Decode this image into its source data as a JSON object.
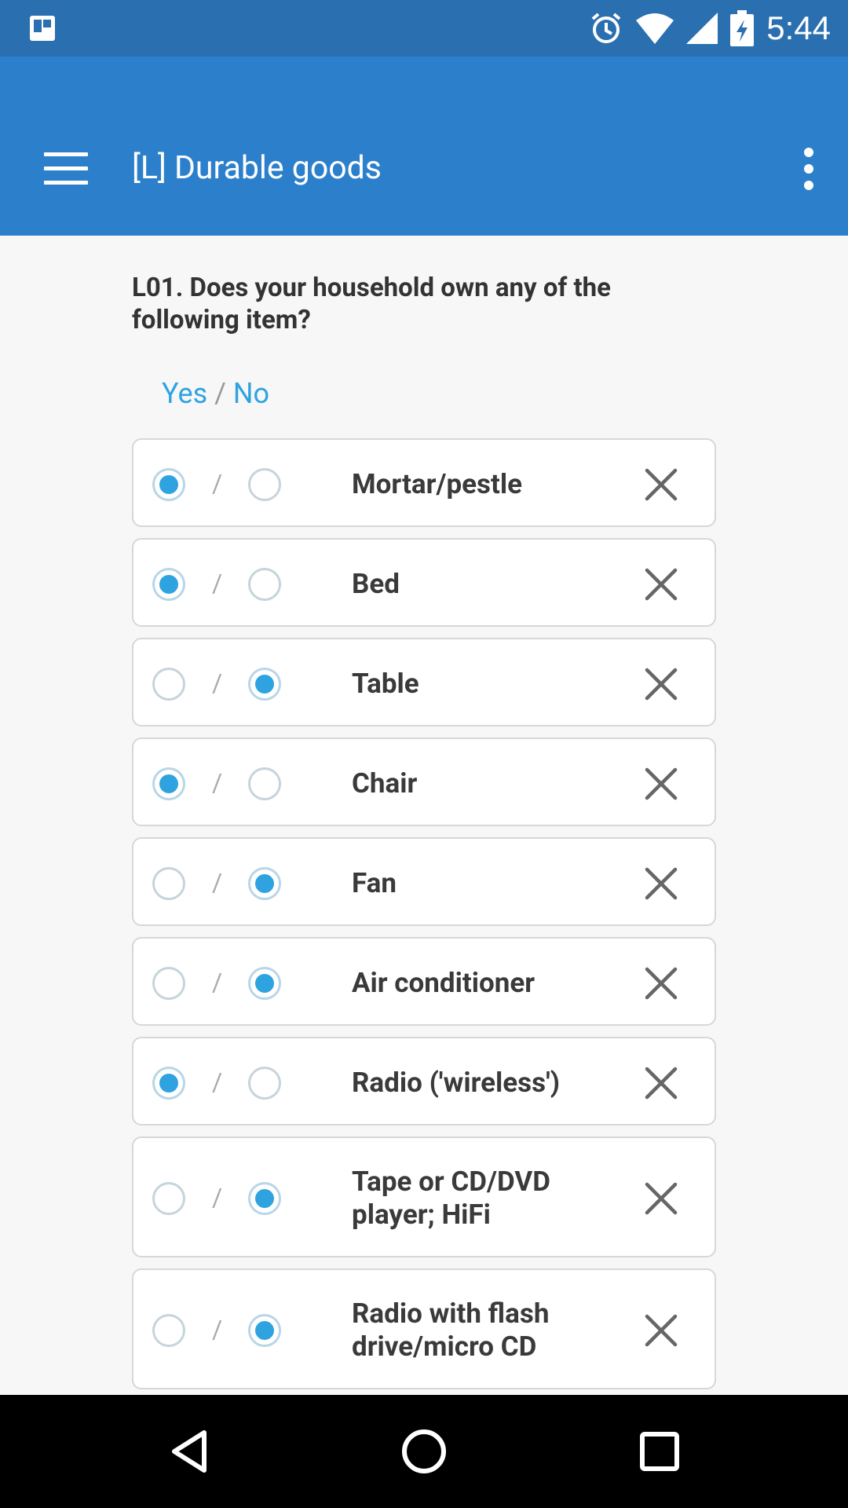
{
  "status_bar": {
    "time": "5:44",
    "icons": [
      "notification-icon",
      "alarm-icon",
      "wifi-icon",
      "signal-icon",
      "battery-icon"
    ]
  },
  "app_bar": {
    "title": "[L] Durable goods",
    "menu_icon": "hamburger-icon",
    "overflow_icon": "more-vert-icon"
  },
  "question": {
    "text": "L01. Does your household own any of the following item?",
    "header_yes": "Yes",
    "header_sep": " / ",
    "header_no": "No"
  },
  "items": [
    {
      "label": "Mortar/pestle",
      "answer": "yes"
    },
    {
      "label": "Bed",
      "answer": "yes"
    },
    {
      "label": "Table",
      "answer": "no"
    },
    {
      "label": "Chair",
      "answer": "yes"
    },
    {
      "label": "Fan",
      "answer": "no"
    },
    {
      "label": "Air conditioner",
      "answer": "no"
    },
    {
      "label": "Radio ('wireless')",
      "answer": "yes"
    },
    {
      "label": "Tape or CD/DVD player; HiFi",
      "answer": "no"
    },
    {
      "label": "Radio with flash drive/micro CD",
      "answer": "no"
    }
  ],
  "separator": "/",
  "colors": {
    "status_bar": "#2a6faf",
    "app_bar": "#2c80cb",
    "accent": "#2fa3e0"
  },
  "nav_bar": [
    "back-icon",
    "home-icon",
    "recents-icon"
  ]
}
